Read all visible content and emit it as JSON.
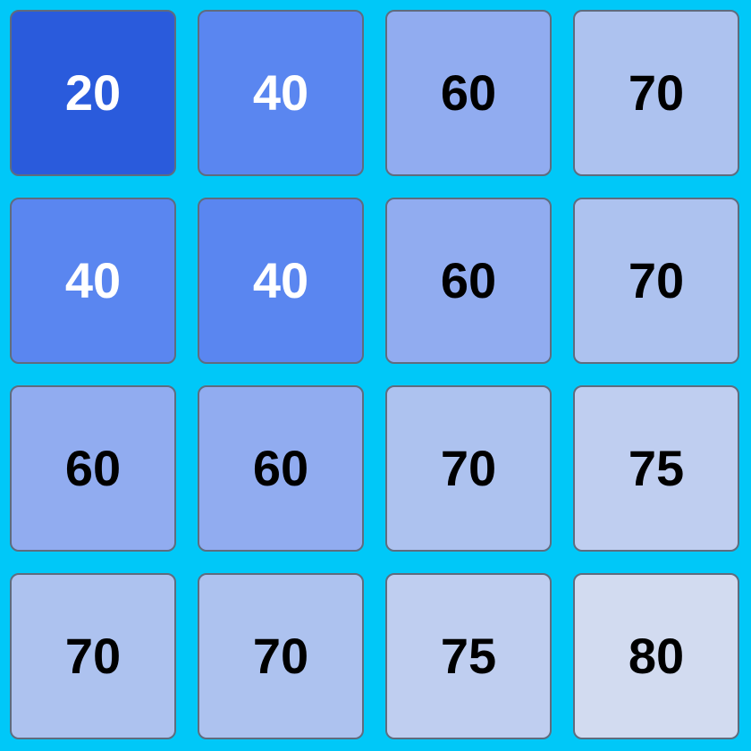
{
  "board": {
    "background_color": "#00c8f8",
    "tiles": [
      {
        "label": "20",
        "bg": "#2a5bdc",
        "fg": "#ffffff"
      },
      {
        "label": "40",
        "bg": "#5a86f0",
        "fg": "#ffffff"
      },
      {
        "label": "60",
        "bg": "#91acf0",
        "fg": "#000000"
      },
      {
        "label": "70",
        "bg": "#adc2ef",
        "fg": "#000000"
      },
      {
        "label": "40",
        "bg": "#5a86f0",
        "fg": "#ffffff"
      },
      {
        "label": "40",
        "bg": "#5a86f0",
        "fg": "#ffffff"
      },
      {
        "label": "60",
        "bg": "#91acf0",
        "fg": "#000000"
      },
      {
        "label": "70",
        "bg": "#adc2ef",
        "fg": "#000000"
      },
      {
        "label": "60",
        "bg": "#91acf0",
        "fg": "#000000"
      },
      {
        "label": "60",
        "bg": "#91acf0",
        "fg": "#000000"
      },
      {
        "label": "70",
        "bg": "#adc2ef",
        "fg": "#000000"
      },
      {
        "label": "75",
        "bg": "#bfcef0",
        "fg": "#000000"
      },
      {
        "label": "70",
        "bg": "#adc2ef",
        "fg": "#000000"
      },
      {
        "label": "70",
        "bg": "#adc2ef",
        "fg": "#000000"
      },
      {
        "label": "75",
        "bg": "#bfcef0",
        "fg": "#000000"
      },
      {
        "label": "80",
        "bg": "#d2dbf0",
        "fg": "#000000"
      }
    ]
  }
}
